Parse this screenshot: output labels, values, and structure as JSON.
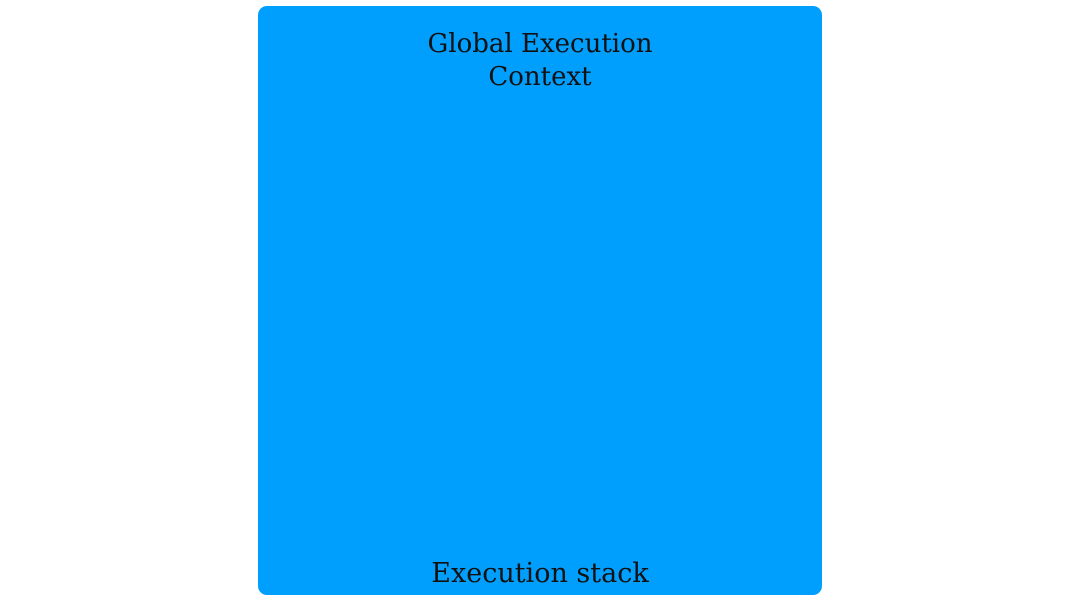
{
  "colors": {
    "stack_fill": "#009ffe",
    "text": "#111111",
    "background": "#ffffff"
  },
  "execution_stack": {
    "label": "Execution stack",
    "contexts": [
      {
        "title_lines": [
          "Global Execution",
          "Context"
        ]
      }
    ]
  }
}
